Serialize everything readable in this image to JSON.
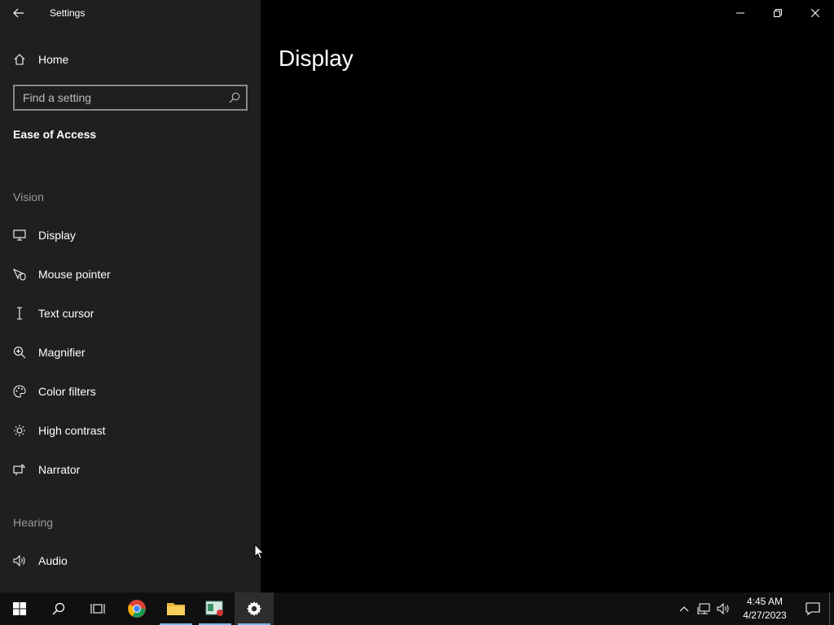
{
  "window": {
    "title": "Settings"
  },
  "sidebar": {
    "home_label": "Home",
    "search_placeholder": "Find a setting",
    "section_title": "Ease of Access",
    "groups": [
      {
        "label": "Vision"
      },
      {
        "label": "Hearing"
      }
    ],
    "items": [
      {
        "label": "Display",
        "icon": "monitor-icon"
      },
      {
        "label": "Mouse pointer",
        "icon": "mouse-pointer-icon"
      },
      {
        "label": "Text cursor",
        "icon": "text-cursor-icon"
      },
      {
        "label": "Magnifier",
        "icon": "magnifier-icon"
      },
      {
        "label": "Color filters",
        "icon": "palette-icon"
      },
      {
        "label": "High contrast",
        "icon": "sun-icon"
      },
      {
        "label": "Narrator",
        "icon": "narrator-icon"
      },
      {
        "label": "Audio",
        "icon": "speaker-icon"
      }
    ]
  },
  "main": {
    "page_title": "Display"
  },
  "taskbar": {
    "clock_time": "4:45 AM",
    "clock_date": "4/27/2023",
    "accent_color": "#76b9ed"
  }
}
